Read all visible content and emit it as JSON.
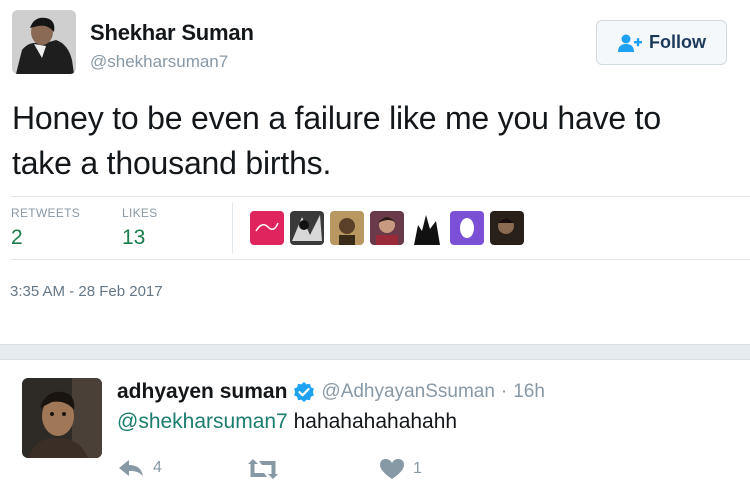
{
  "tweet": {
    "author_name": "Shekhar Suman",
    "author_handle": "@shekharsuman7",
    "follow_label": "Follow",
    "text_line1": "Honey to be even a failure like me you have to",
    "text_line2": "take a thousand births.",
    "retweets_label": "RETWEETS",
    "retweets_count": "2",
    "likes_label": "LIKES",
    "likes_count": "13",
    "timestamp": "3:35 AM - 28 Feb 2017",
    "liker_colors": [
      "#e0245e",
      "#2a2a2a",
      "#8a6a3a",
      "#6b3a4a",
      "#1a1a1a",
      "#7b4fd6",
      "#4a3a30"
    ]
  },
  "reply": {
    "author_name": "adhyayen suman",
    "author_handle": "@AdhyayanSsuman",
    "separator": "·",
    "time": "16h",
    "mention": "@shekharsuman7",
    "text": " hahahahahahahh",
    "reply_count": "4",
    "like_count": "1"
  },
  "colors": {
    "accent_green": "#1a7d4b",
    "muted": "#8899a6",
    "verified_blue": "#1da1f2",
    "gap_gray": "#e6ecf0"
  }
}
